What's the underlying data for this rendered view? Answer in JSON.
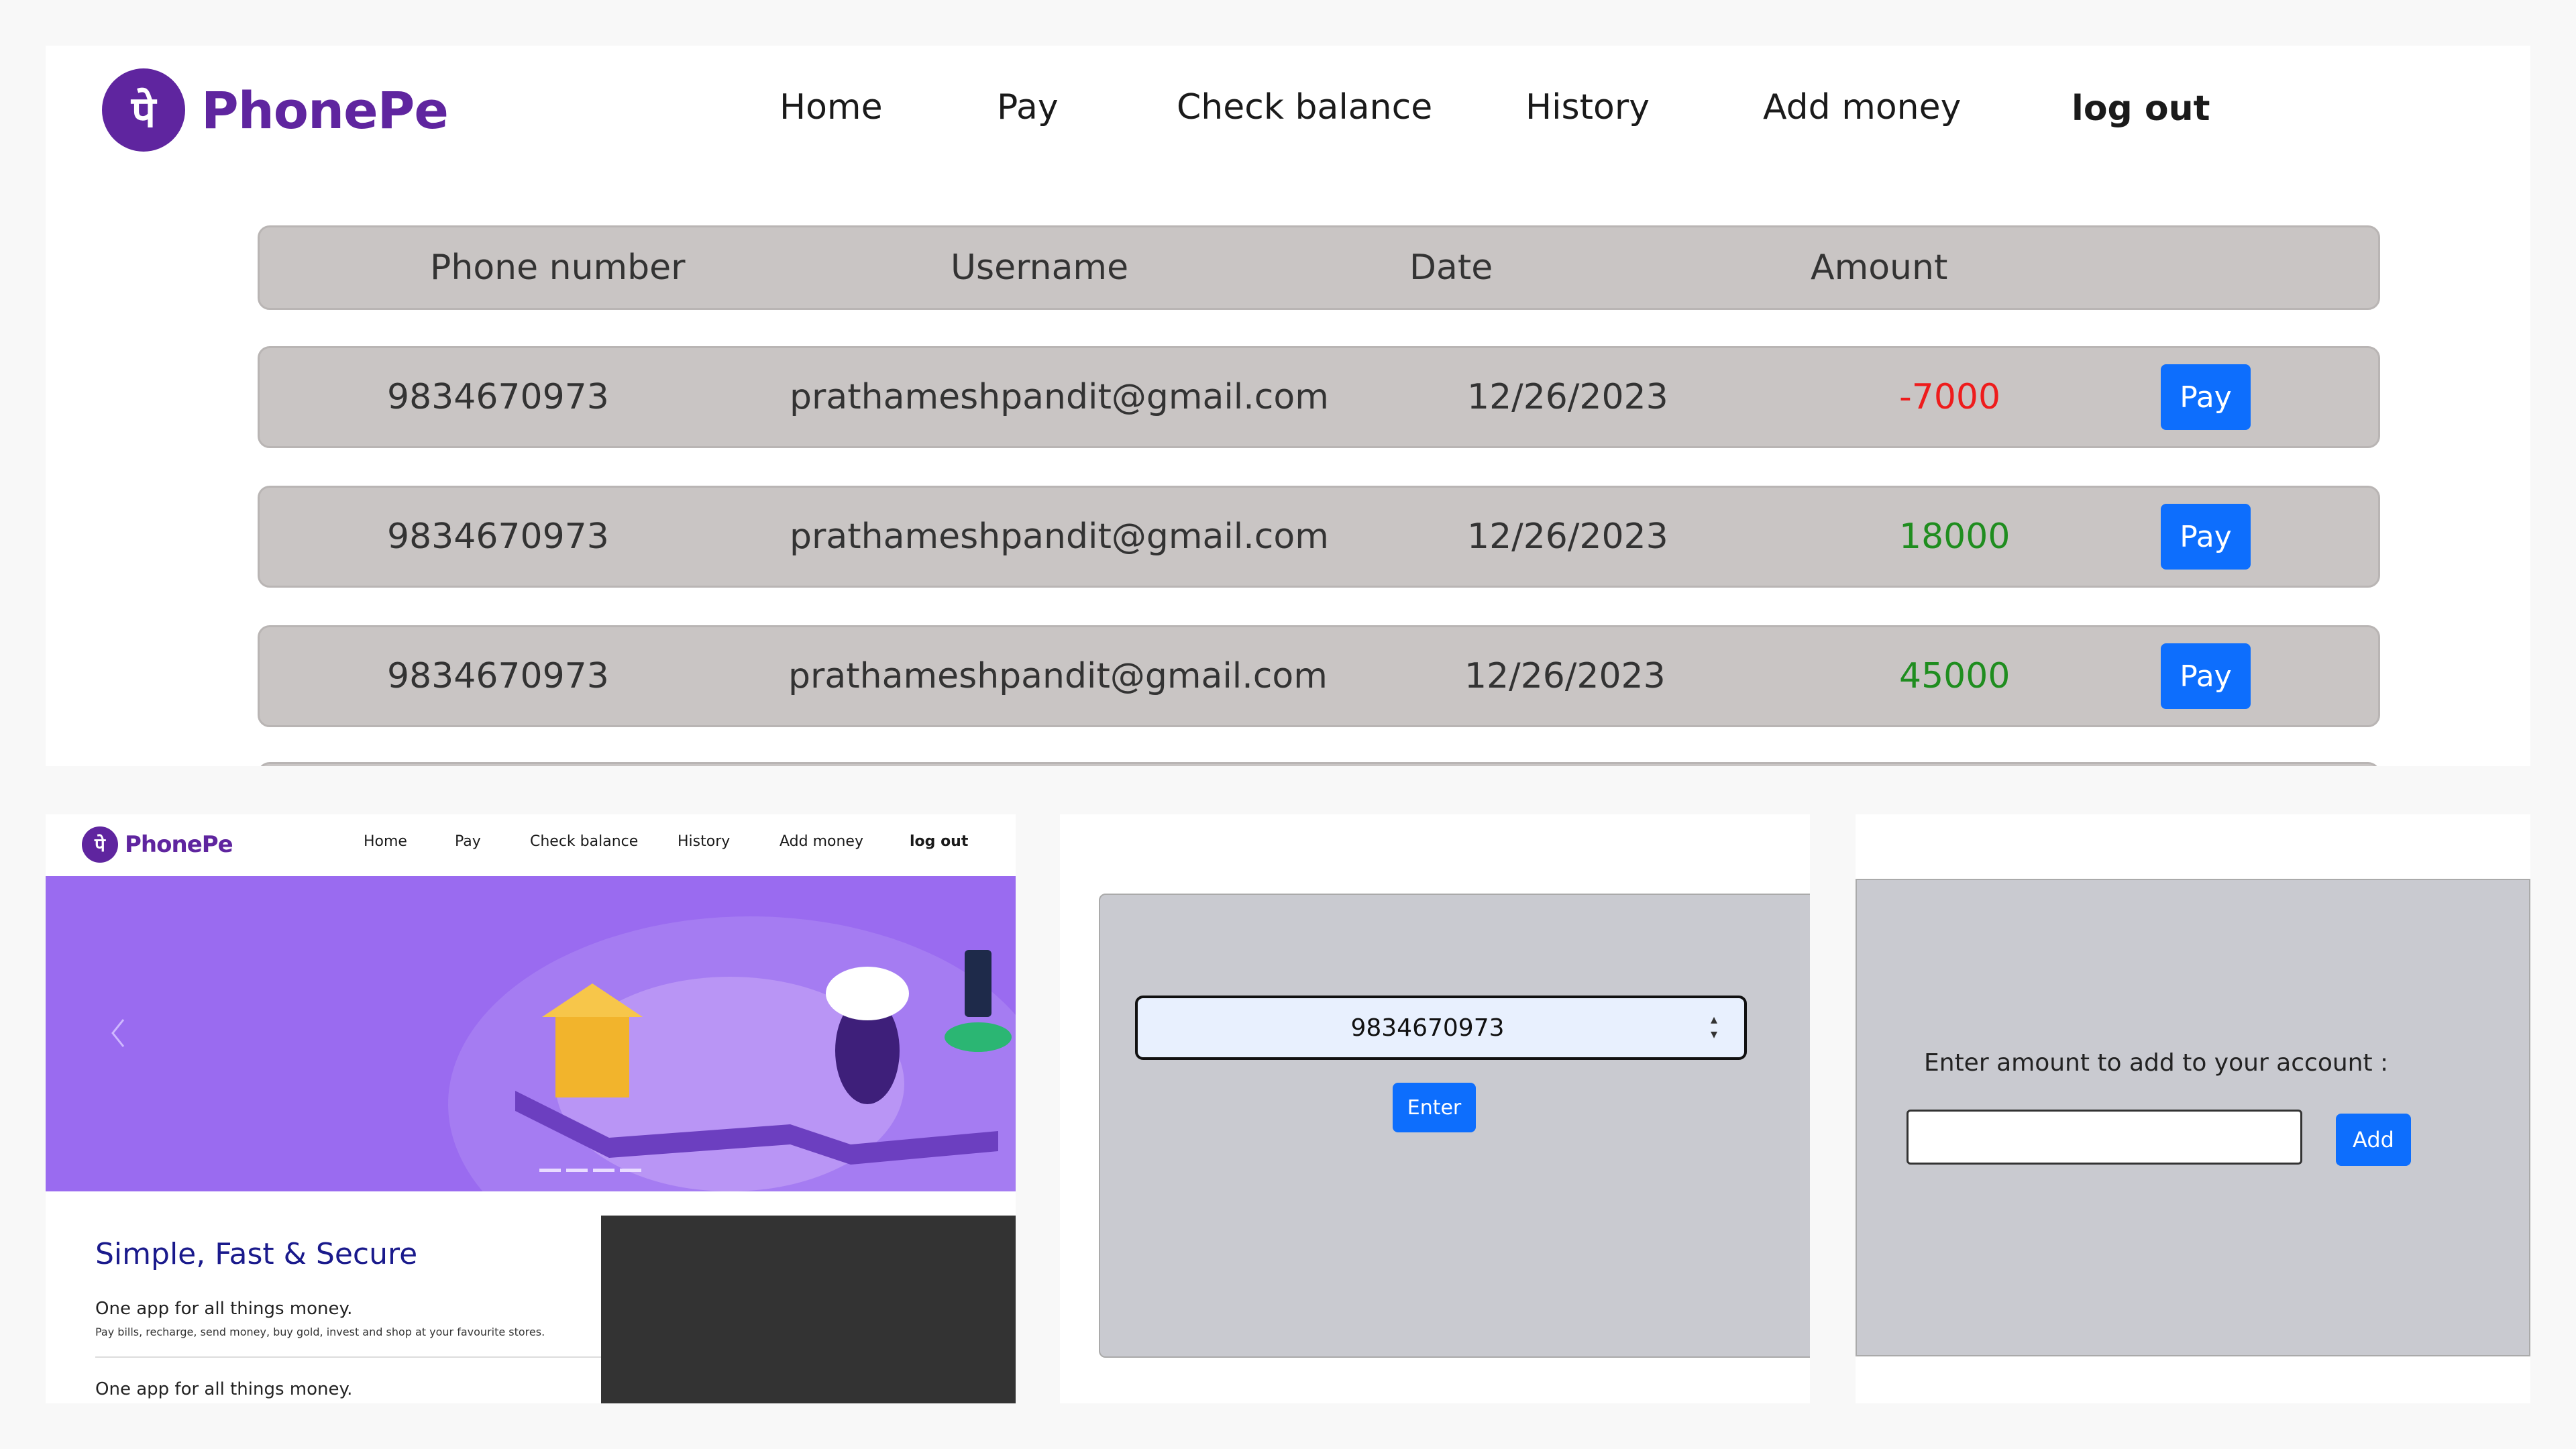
{
  "brand": {
    "logo_glyph": "पे",
    "name": "PhonePe",
    "color": "#5f259f"
  },
  "nav": {
    "home": "Home",
    "pay": "Pay",
    "check_balance": "Check balance",
    "history": "History",
    "add_money": "Add money",
    "logout": "log out"
  },
  "history_table": {
    "headers": {
      "phone": "Phone number",
      "username": "Username",
      "date": "Date",
      "amount": "Amount"
    },
    "rows": [
      {
        "phone": "9834670973",
        "username": "prathameshpandit@gmail.com",
        "date": "12/26/2023",
        "amount": "-7000",
        "action": "Pay"
      },
      {
        "phone": "9834670973",
        "username": "prathameshpandit@gmail.com",
        "date": "12/26/2023",
        "amount": "18000",
        "action": "Pay"
      },
      {
        "phone": "9834670973",
        "username": "prathameshpandit@gmail.com",
        "date": "12/26/2023",
        "amount": "45000",
        "action": "Pay"
      }
    ],
    "colors": {
      "negative": "#ee1c1c",
      "positive": "#1f8d1f",
      "button": "#0d6efd"
    }
  },
  "home": {
    "hero_prev_icon": "chevron-left-icon",
    "title": "Simple, Fast & Secure",
    "tagline": "One app for all things money.",
    "description": "Pay bills, recharge, send money, buy gold, invest and shop at your favourite stores.",
    "tagline_repeat": "One app for all things money."
  },
  "balance": {
    "phone_value": "9834670973",
    "enter_label": "Enter"
  },
  "add_money": {
    "prompt": "Enter amount to add to your account :",
    "input_value": "",
    "add_label": "Add"
  }
}
